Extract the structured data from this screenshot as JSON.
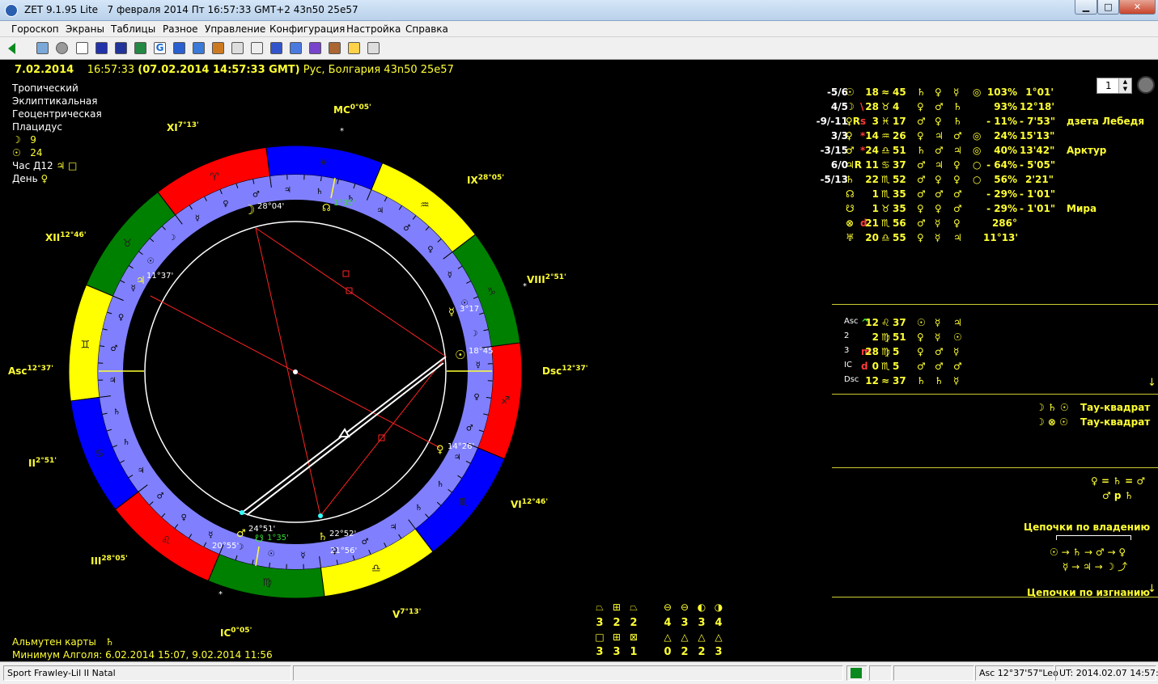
{
  "window": {
    "app": "ZET 9.1.95 Lite",
    "title_info": "7 февраля 2014  Пт  16:57:33 GMT+2 43n50  25e57"
  },
  "menu": [
    "Гороскоп",
    "Экраны",
    "Таблицы",
    "Разное",
    "Управление",
    "Конфигурация",
    "Настройка",
    "Справка"
  ],
  "toolbar": {
    "spin_value": "1"
  },
  "header": {
    "date": "7.02.2014",
    "time": "16:57:33",
    "gmt": "(07.02.2014  14:57:33 GMT)",
    "place": "Рус, Болгария 43n50  25e57"
  },
  "settings": [
    "Тропический",
    "Эклиптикальная",
    "Геоцентрическая",
    "Плацидус"
  ],
  "info": {
    "moon_glyph": "☽",
    "moon_day": "9",
    "sun_glyph": "☉",
    "sun_day": "24",
    "hour_label": "Час Д12",
    "hour_glyph": "♃ □",
    "day_label": "День",
    "day_glyph": "♀"
  },
  "houses": {
    "mc": "MC",
    "mc_deg": "0°05'",
    "ix": "IX",
    "ix_deg": "28°05'",
    "xi": "XI",
    "xi_deg": "7°13'",
    "viii": "VIII",
    "viii_deg": "2°51'",
    "xii": "XII",
    "xii_deg": "12°46'",
    "asc": "Asc",
    "asc_deg": "12°37'",
    "dsc": "Dsc",
    "dsc_deg": "12°37'",
    "ii": "II",
    "ii_deg": "2°51'",
    "vi": "VI",
    "vi_deg": "12°46'",
    "iii": "III",
    "iii_deg": "28°05'",
    "v": "V",
    "v_deg": "7°13'",
    "ic": "IC",
    "ic_deg": "0°05'"
  },
  "chart_marks": {
    "moon": "28°04'",
    "node_top": "1°35'",
    "jup": "11°37'",
    "merc": "3°17",
    "sun": "18°45",
    "venus": "14°26'",
    "mars": "24°51'",
    "node_bottom": "1°35'",
    "sat": "22°52'",
    "pt1": "20°55'",
    "pt2": "21°56'"
  },
  "planets": [
    {
      "score": "-5/6",
      "glyph": "☉",
      "deg": "18",
      "sign": "≈",
      "min": "45",
      "r1": "♄",
      "r2": "♀",
      "r3": "☿",
      "r4": "◎",
      "pct": "103%",
      "orb": "1°01'",
      "star": "",
      "mark": ""
    },
    {
      "score": "4/5",
      "glyph": "☽",
      "deg": "28",
      "sign": "♉",
      "min": "4",
      "r1": "♀",
      "r2": "♂",
      "r3": "♄",
      "r4": "",
      "pct": "93%",
      "orb": "12°18'",
      "star": "",
      "mark": "\\"
    },
    {
      "score": "-9/-11",
      "glyph": "♀R",
      "deg": "3",
      "sign": "♓",
      "min": "17",
      "r1": "♂",
      "r2": "♀",
      "r3": "♄",
      "r4": "",
      "pct": "- 11%",
      "orb": "- 7'53\"",
      "star": "дзета Лебедя",
      "mark": "s"
    },
    {
      "score": "3/3",
      "glyph": "♀",
      "deg": "14",
      "sign": "♒",
      "min": "26",
      "r1": "♀",
      "r2": "♃",
      "r3": "♂",
      "r4": "◎",
      "pct": "24%",
      "orb": "15'13\"",
      "star": "",
      "mark": "*"
    },
    {
      "score": "-3/15",
      "glyph": "♂",
      "deg": "24",
      "sign": "♎",
      "min": "51",
      "r1": "♄",
      "r2": "♂",
      "r3": "♃",
      "r4": "◎",
      "pct": "40%",
      "orb": "13'42\"",
      "star": "Арктур",
      "mark": "*"
    },
    {
      "score": "6/0",
      "glyph": "♃R",
      "deg": "11",
      "sign": "♋",
      "min": "37",
      "r1": "♂",
      "r2": "♃",
      "r3": "♀",
      "r4": "○",
      "pct": "- 64%",
      "orb": "- 5'05\"",
      "star": "",
      "mark": ""
    },
    {
      "score": "-5/13",
      "glyph": "♄",
      "deg": "22",
      "sign": "♏",
      "min": "52",
      "r1": "♂",
      "r2": "♀",
      "r3": "♀",
      "r4": "○",
      "pct": "56%",
      "orb": "2'21\"",
      "star": "",
      "mark": ""
    },
    {
      "score": "",
      "glyph": "☊",
      "deg": "1",
      "sign": "♏",
      "min": "35",
      "r1": "♂",
      "r2": "♂",
      "r3": "♂",
      "r4": "",
      "pct": "- 29%",
      "orb": "- 1'01\"",
      "star": "",
      "mark": ""
    },
    {
      "score": "",
      "glyph": "☋",
      "deg": "1",
      "sign": "♉",
      "min": "35",
      "r1": "♀",
      "r2": "♀",
      "r3": "♂",
      "r4": "",
      "pct": "- 29%",
      "orb": "- 1'01\"",
      "star": "Мира",
      "mark": ""
    },
    {
      "score": "",
      "glyph": "⊗",
      "deg": "21",
      "sign": "♏",
      "min": "56",
      "r1": "♂",
      "r2": "☿",
      "r3": "♀",
      "r4": "",
      "pct": "286°",
      "orb": "",
      "star": "",
      "mark": "d"
    },
    {
      "score": "",
      "glyph": "♅",
      "deg": "20",
      "sign": "♎",
      "min": "55",
      "r1": "♀",
      "r2": "☿",
      "r3": "♃",
      "r4": "",
      "pct": "11°13'",
      "orb": "",
      "star": "",
      "mark": ""
    }
  ],
  "angles": [
    {
      "name": "Asc",
      "mark": "^",
      "deg": "12",
      "sign": "♌",
      "min": "37",
      "r1": "☉",
      "r2": "☿",
      "r3": "♃"
    },
    {
      "name": "2",
      "mark": "",
      "deg": "2",
      "sign": "♍",
      "min": "51",
      "r1": "♀",
      "r2": "☿",
      "r3": "☉"
    },
    {
      "name": "3",
      "mark": "m",
      "deg": "28",
      "sign": "♍",
      "min": "5",
      "r1": "♀",
      "r2": "♂",
      "r3": "☿"
    },
    {
      "name": "IC",
      "mark": "d",
      "deg": "0",
      "sign": "♏",
      "min": "5",
      "r1": "♂",
      "r2": "♂",
      "r3": "♂"
    },
    {
      "name": "Dsc",
      "mark": "",
      "deg": "12",
      "sign": "≈",
      "min": "37",
      "r1": "♄",
      "r2": "♄",
      "r3": "☿"
    }
  ],
  "aspects": [
    {
      "glyphs": "☽ ♄ ☉",
      "name": "Тау-квадрат"
    },
    {
      "glyphs": "☽ ⊗ ☉",
      "name": "Тау-квадрат"
    }
  ],
  "receptions": {
    "line1": "♀ = ♄ = ♂",
    "line2": "♂ p ♄"
  },
  "chains": {
    "ownership": "Цепочки по владению",
    "chain1": "☉ → ♄ → ♂ → ♀",
    "chain2": "☿ → ♃ → ☽ ⤴",
    "exile": "Цепочки по изгнанию",
    "arrow": "↓"
  },
  "counts": {
    "top": [
      "3",
      "2",
      "2",
      "4",
      "3",
      "3",
      "4"
    ],
    "bottom": [
      "3",
      "3",
      "1",
      "0",
      "2",
      "2",
      "3"
    ]
  },
  "footer": {
    "almuten_label": "Альмутен карты",
    "almuten_glyph": "♄",
    "algol": "Минимум Алголя: 6.02.2014 15:07,  9.02.2014 11:56"
  },
  "status": {
    "left": "Sport Frawley-Lil II Natal",
    "asc": "Asc  12°37'57\"Leo",
    "ut": "UT: 2014.02.07 14:57:38"
  },
  "colors": {
    "fire": "#ff0000",
    "earth": "#008000",
    "air": "#ffff00",
    "water": "#0000ff",
    "ring": "#8080ff",
    "text": "#ffff33"
  }
}
